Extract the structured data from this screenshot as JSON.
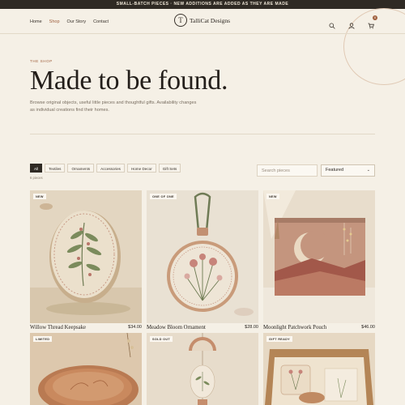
{
  "announcement": "SMALL-BATCH PIECES · NEW ADDITIONS ARE ADDED AS THEY ARE MADE",
  "nav": {
    "links": [
      {
        "label": "Home",
        "active": false
      },
      {
        "label": "Shop",
        "active": true
      },
      {
        "label": "Our Story",
        "active": false
      },
      {
        "label": "Contact",
        "active": false
      }
    ],
    "logo_mark": "T",
    "logo_text": "TalliCat Designs",
    "cart_count": "0",
    "icons": [
      "search-icon",
      "account-icon",
      "cart-icon"
    ]
  },
  "hero": {
    "eyebrow": "THE SHOP",
    "headline": "Made to be found.",
    "subtitle": "Browse original objects, useful little pieces and thoughtful gifts. Availability changes as individual creations find their homes."
  },
  "filters": {
    "chips": [
      "All",
      "Textiles",
      "Ornaments",
      "Accessories",
      "Home Decor",
      "Gift Sets"
    ],
    "active": "All",
    "count": "6 pieces",
    "search_placeholder": "Search pieces",
    "sort_value": "Featured"
  },
  "products": [
    {
      "badge": "NEW",
      "title": "Willow Thread Keepsake",
      "price": "$34.00"
    },
    {
      "badge": "ONE OF ONE",
      "title": "Meadow Bloom Ornament",
      "price": "$28.00"
    },
    {
      "badge": "NEW",
      "title": "Moonlight Patchwork Pouch",
      "price": "$46.00"
    },
    {
      "badge": "LIMITED",
      "title": "",
      "price": ""
    },
    {
      "badge": "SOLD OUT",
      "title": "",
      "price": ""
    },
    {
      "badge": "GIFT READY",
      "title": "",
      "price": ""
    }
  ],
  "colors": {
    "accent": "#a0613f",
    "dark": "#2f2a24",
    "background": "#f5f0e6"
  }
}
